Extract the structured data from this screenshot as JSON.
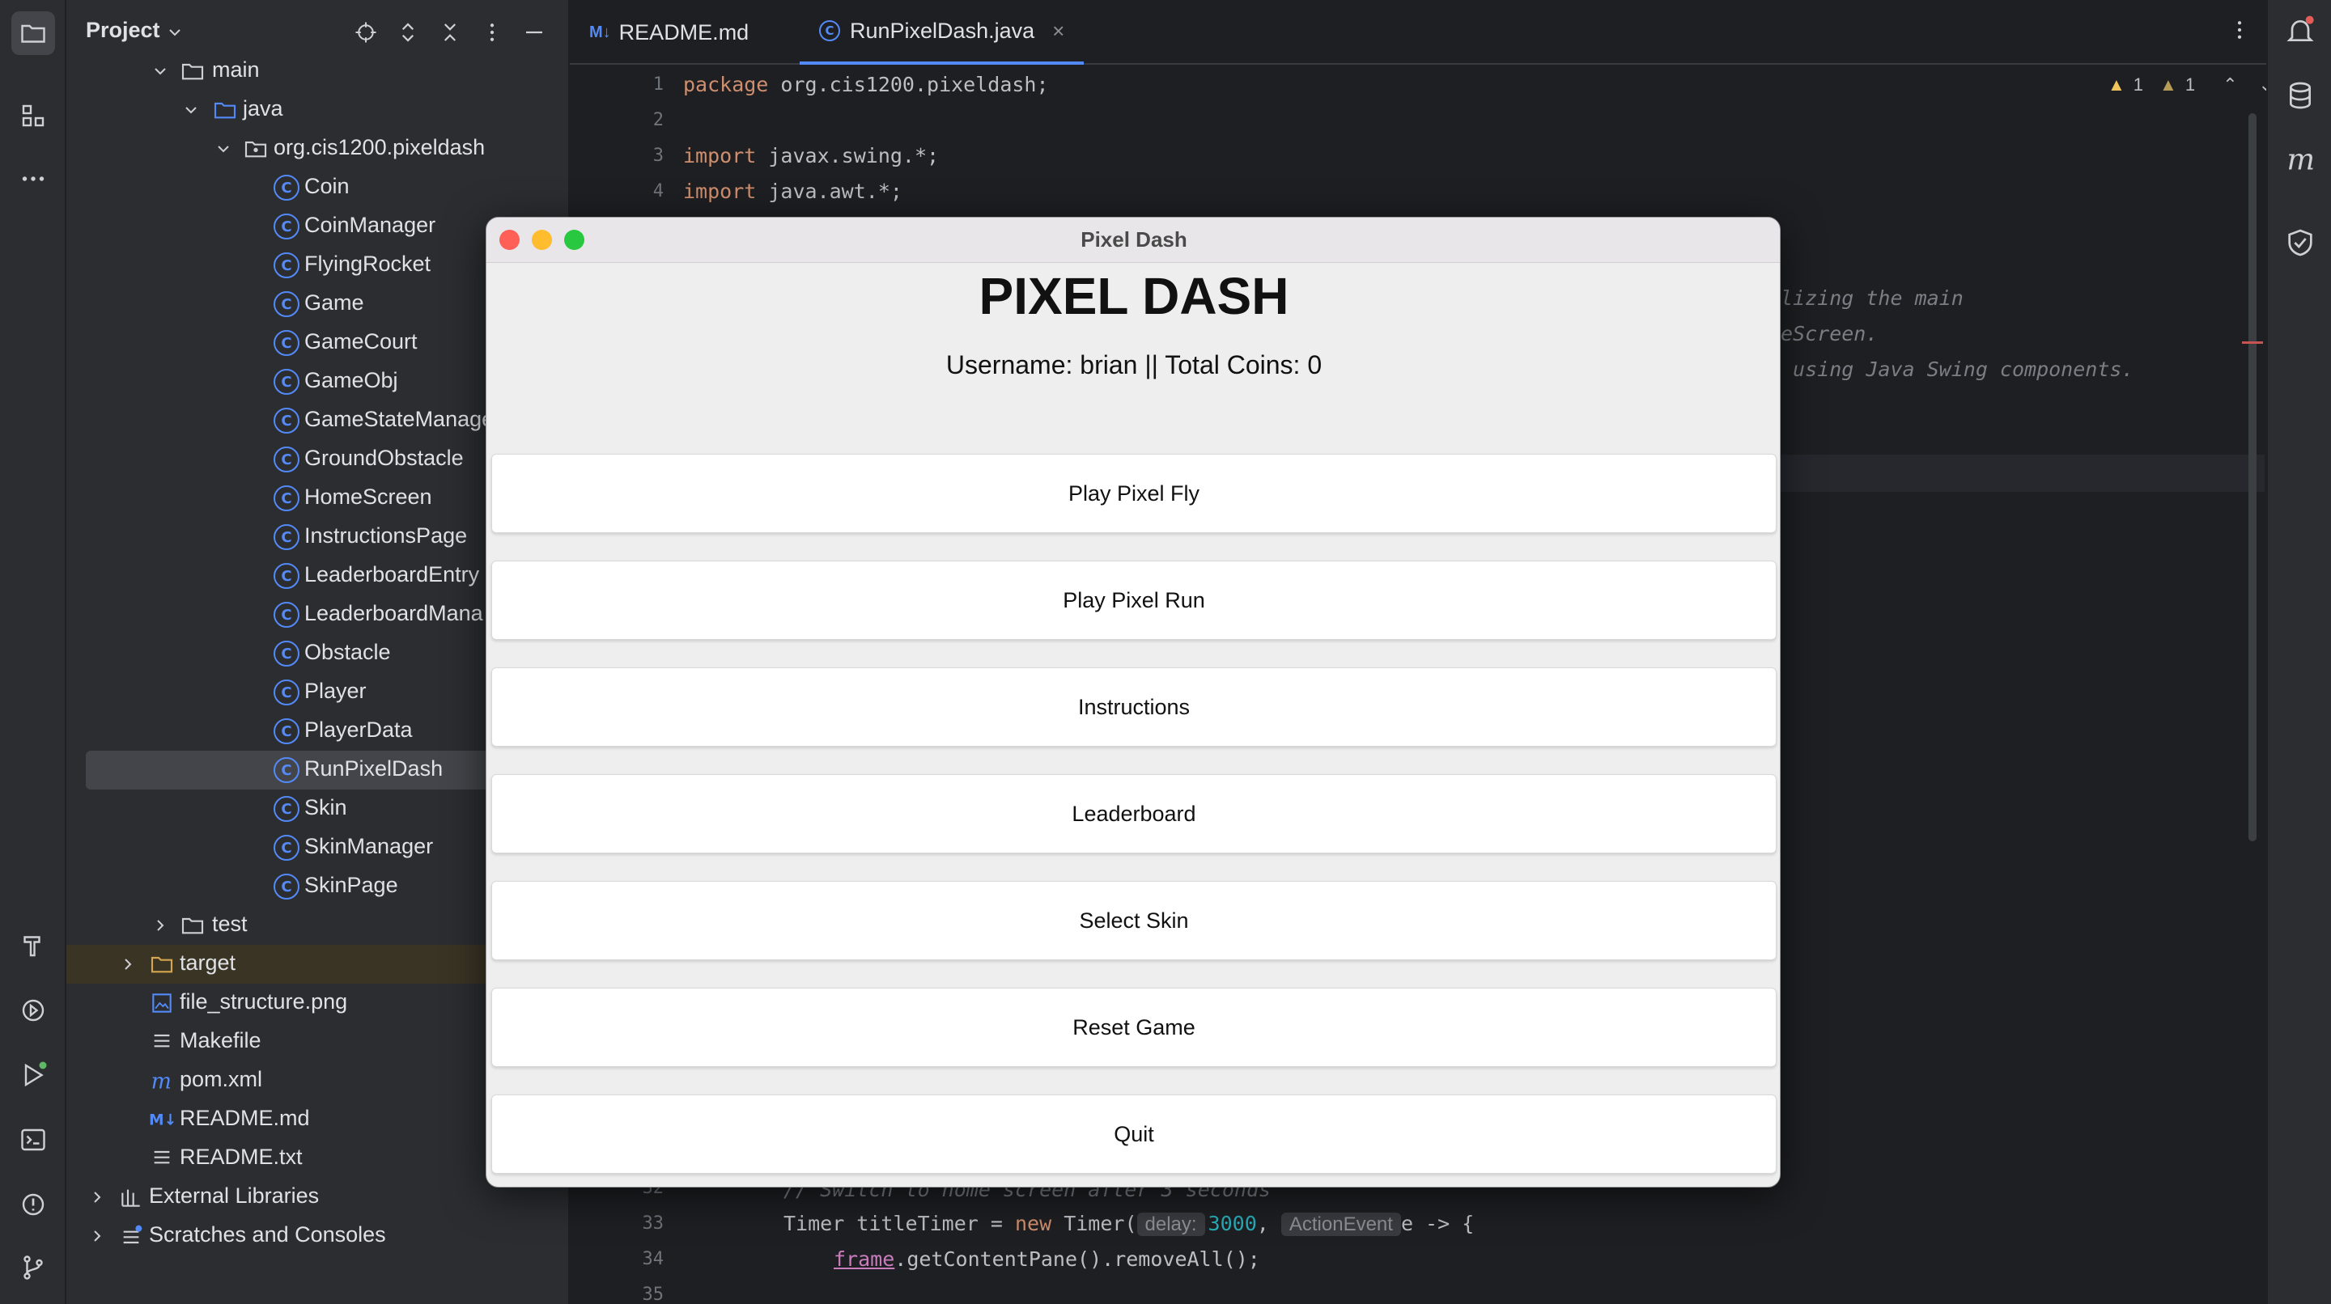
{
  "project_panel": {
    "title": "Project",
    "tree": [
      {
        "label": "main",
        "kind": "folder"
      },
      {
        "label": "java",
        "kind": "folder"
      },
      {
        "label": "org.cis1200.pixeldash",
        "kind": "package"
      },
      {
        "label": "Coin",
        "kind": "class"
      },
      {
        "label": "CoinManager",
        "kind": "class"
      },
      {
        "label": "FlyingRocket",
        "kind": "class"
      },
      {
        "label": "Game",
        "kind": "class"
      },
      {
        "label": "GameCourt",
        "kind": "class"
      },
      {
        "label": "GameObj",
        "kind": "class"
      },
      {
        "label": "GameStateManage",
        "kind": "class"
      },
      {
        "label": "GroundObstacle",
        "kind": "class"
      },
      {
        "label": "HomeScreen",
        "kind": "class"
      },
      {
        "label": "InstructionsPage",
        "kind": "class"
      },
      {
        "label": "LeaderboardEntry",
        "kind": "class"
      },
      {
        "label": "LeaderboardMana",
        "kind": "class"
      },
      {
        "label": "Obstacle",
        "kind": "class"
      },
      {
        "label": "Player",
        "kind": "class"
      },
      {
        "label": "PlayerData",
        "kind": "class"
      },
      {
        "label": "RunPixelDash",
        "kind": "class",
        "selected": true
      },
      {
        "label": "Skin",
        "kind": "class"
      },
      {
        "label": "SkinManager",
        "kind": "class"
      },
      {
        "label": "SkinPage",
        "kind": "class"
      },
      {
        "label": "test",
        "kind": "folder"
      },
      {
        "label": "target",
        "kind": "folder"
      },
      {
        "label": "file_structure.png",
        "kind": "image"
      },
      {
        "label": "Makefile",
        "kind": "text"
      },
      {
        "label": "pom.xml",
        "kind": "maven"
      },
      {
        "label": "README.md",
        "kind": "markdown"
      },
      {
        "label": "README.txt",
        "kind": "text"
      },
      {
        "label": "External Libraries",
        "kind": "libraries"
      },
      {
        "label": "Scratches and Consoles",
        "kind": "scratches"
      }
    ]
  },
  "tabs": [
    {
      "label": "README.md",
      "icon": "markdown-icon",
      "active": false
    },
    {
      "label": "RunPixelDash.java",
      "icon": "java-class-icon",
      "active": true
    }
  ],
  "editor": {
    "inspections": {
      "warnings_a": "1",
      "warnings_b": "1"
    },
    "lines": {
      "l1": "1",
      "l2": "2",
      "l3": "3",
      "l4": "4",
      "l32": "32",
      "l33": "33",
      "l34": "34",
      "l35": "35"
    },
    "code": {
      "line1_kw": "package",
      "line1_rest": " org.cis1200.pixeldash;",
      "line3_kw": "import",
      "line3_rest": " javax.swing.*;",
      "line4_kw": "import",
      "line4_rest": " java.awt.*;",
      "comment_a": "lizing the main",
      "comment_b": "eScreen.",
      "comment_c": " using Java Swing components.",
      "line32": "// Switch to home screen after 3 seconds",
      "line33_a": "Timer titleTimer = ",
      "line33_new": "new",
      "line33_b": " Timer(",
      "line33_hint1": "delay:",
      "line33_num": "3000",
      "line33_c": ", ",
      "line33_hint2": "ActionEvent",
      "line33_d": "e -> {",
      "line34_field": "frame",
      "line34_rest": ".getContentPane().removeAll();"
    }
  },
  "app_window": {
    "title": "Pixel Dash",
    "heading": "PIXEL DASH",
    "user_info": "Username: brian  ||  Total Coins: 0",
    "buttons": [
      "Play Pixel Fly",
      "Play Pixel Run",
      "Instructions",
      "Leaderboard",
      "Select Skin",
      "Reset Game",
      "Quit"
    ]
  },
  "colors": {
    "accent": "#548af7",
    "traffic_close": "#fe5f57",
    "traffic_min": "#febc2e",
    "traffic_max": "#28c840"
  }
}
